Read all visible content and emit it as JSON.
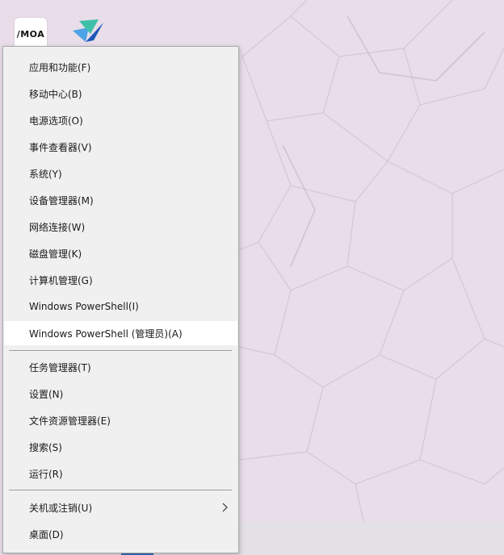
{
  "desktop": {
    "icons": [
      {
        "name": "moa-app",
        "label": "/MOA"
      },
      {
        "name": "bird-app",
        "label": ""
      }
    ]
  },
  "context_menu": {
    "items": [
      {
        "label": "应用和功能(F)"
      },
      {
        "label": "移动中心(B)"
      },
      {
        "label": "电源选项(O)"
      },
      {
        "label": "事件查看器(V)"
      },
      {
        "label": "系统(Y)"
      },
      {
        "label": "设备管理器(M)"
      },
      {
        "label": "网络连接(W)"
      },
      {
        "label": "磁盘管理(K)"
      },
      {
        "label": "计算机管理(G)"
      },
      {
        "label": "Windows PowerShell(I)"
      },
      {
        "label": "Windows PowerShell (管理员)(A)"
      },
      {
        "label": "任务管理器(T)"
      },
      {
        "label": "设置(N)"
      },
      {
        "label": "文件资源管理器(E)"
      },
      {
        "label": "搜索(S)"
      },
      {
        "label": "运行(R)"
      },
      {
        "label": "关机或注销(U)"
      },
      {
        "label": "桌面(D)"
      }
    ],
    "highlighted_item": "Windows PowerShell (管理员)(A)"
  },
  "colors": {
    "menu_background": "#f0f0f0",
    "highlight": "#ffffff",
    "wallpaper": "#e8dde9",
    "separator": "#9c9c9c"
  }
}
